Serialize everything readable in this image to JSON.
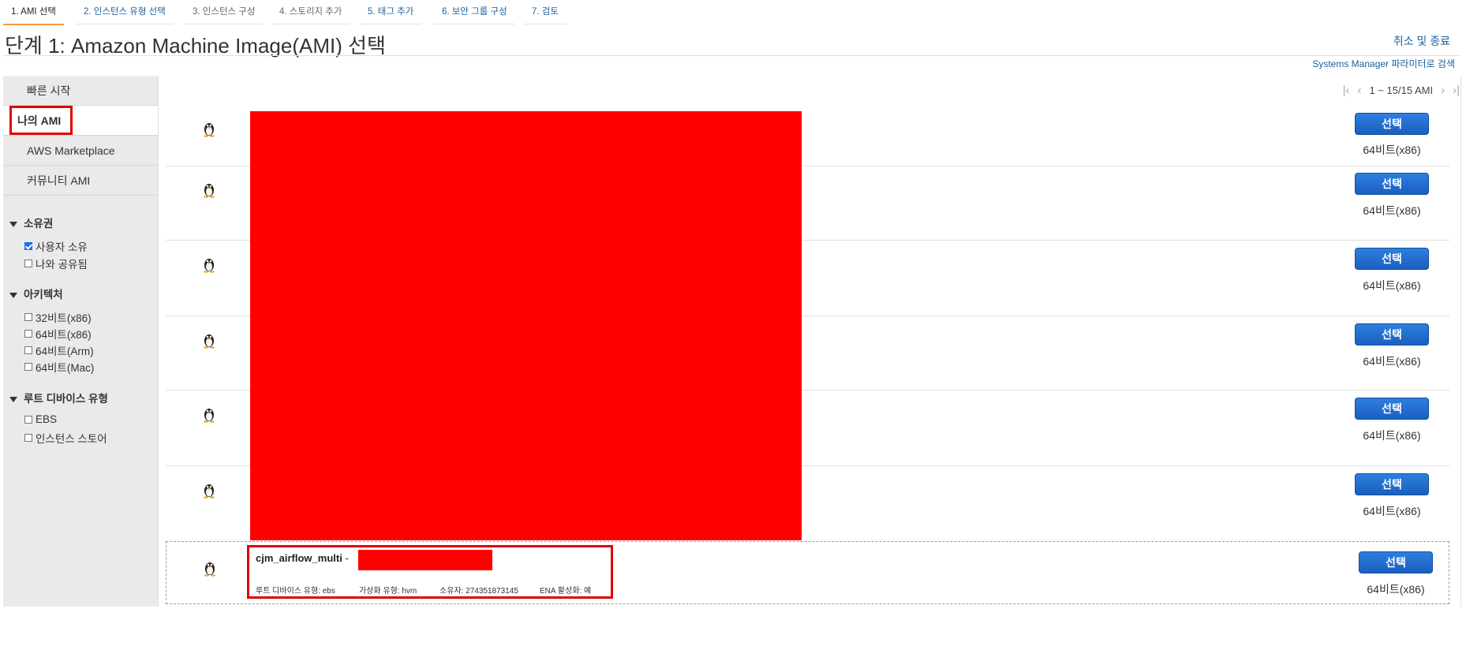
{
  "steps": [
    "1. AMI 선택",
    "2. 인스턴스 유형 선택",
    "3. 인스턴스 구성",
    "4. 스토리지 추가",
    "5. 태그 추가",
    "6. 보안 그룹 구성",
    "7. 검토"
  ],
  "title": "단계 1: Amazon Machine Image(AMI) 선택",
  "cancel_label": "취소 및 종료",
  "ssm_label": "Systems Manager 파라미터로 검색",
  "sidebar": {
    "items": [
      "빠른 시작",
      "나의 AMI",
      "AWS Marketplace",
      "커뮤니티 AMI"
    ],
    "ownership": {
      "heading": "소유권",
      "options": [
        {
          "label": "사용자 소유",
          "checked": true
        },
        {
          "label": "나와 공유됨",
          "checked": false
        }
      ]
    },
    "architecture": {
      "heading": "아키텍처",
      "options": [
        {
          "label": "32비트(x86)",
          "checked": false
        },
        {
          "label": "64비트(x86)",
          "checked": false
        },
        {
          "label": "64비트(Arm)",
          "checked": false
        },
        {
          "label": "64비트(Mac)",
          "checked": false
        }
      ]
    },
    "root_device": {
      "heading": "루트 디바이스 유형",
      "options": [
        {
          "label": "EBS",
          "checked": false
        },
        {
          "label": "인스턴스 스토어",
          "checked": false
        }
      ]
    }
  },
  "pager": {
    "text": "1 ~ 15/15 AMI"
  },
  "rows": [
    {
      "select_label": "선택",
      "arch": "64비트(x86)"
    },
    {
      "select_label": "선택",
      "arch": "64비트(x86)"
    },
    {
      "select_label": "선택",
      "arch": "64비트(x86)"
    },
    {
      "select_label": "선택",
      "arch": "64비트(x86)"
    },
    {
      "select_label": "선택",
      "arch": "64비트(x86)"
    },
    {
      "select_label": "선택",
      "arch": "64비트(x86)"
    }
  ],
  "last_ami": {
    "name": "cjm_airflow_multi",
    "separator": "-",
    "root_device": "루트 디바이스 유형: ebs",
    "virtualization": "가상화 유형: hvm",
    "owner": "소유자: 274351873145",
    "ena": "ENA 활성화: 예",
    "select_label": "선택",
    "arch": "64비트(x86)"
  },
  "colors": {
    "accent": "#1f5f9e",
    "button": "#1a6fd6",
    "highlight": "#e00000",
    "redact": "#ff0000"
  }
}
